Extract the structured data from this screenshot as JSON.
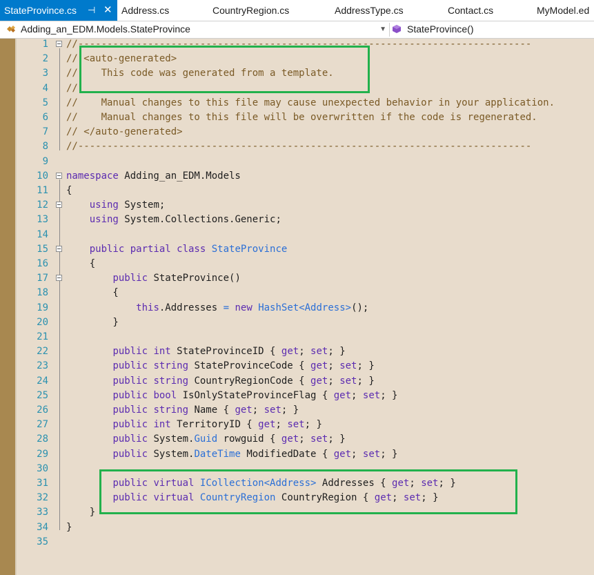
{
  "tabs": [
    {
      "label": "StateProvince.cs",
      "active": true
    },
    {
      "label": "Address.cs"
    },
    {
      "label": "CountryRegion.cs"
    },
    {
      "label": "AddressType.cs"
    },
    {
      "label": "Contact.cs"
    },
    {
      "label": "MyModel.ed"
    }
  ],
  "tab_icons": {
    "pin": "⊣",
    "close": "✕"
  },
  "navbar": {
    "type_scope": "Adding_an_EDM.Models.StateProvince",
    "member_scope": "StateProvince()"
  },
  "colors": {
    "accent": "#007acc",
    "keyword": "#5b2bb0",
    "type": "#2b6fd6",
    "comment": "#7a5a26",
    "line_number": "#2b91af",
    "highlight": "#22b14c",
    "editor_bg": "#e8dccc"
  },
  "lines": [
    {
      "n": "1",
      "fold": true,
      "tokens": [
        {
          "t": "//------------------------------------------------------------------------------",
          "c": "cm"
        }
      ]
    },
    {
      "n": "2",
      "tokens": [
        {
          "t": "// <auto-generated>",
          "c": "cm"
        }
      ]
    },
    {
      "n": "3",
      "tokens": [
        {
          "t": "//    This code was generated from a template.",
          "c": "cm"
        }
      ]
    },
    {
      "n": "4",
      "tokens": [
        {
          "t": "//",
          "c": "cm"
        }
      ]
    },
    {
      "n": "5",
      "tokens": [
        {
          "t": "//    Manual changes to this file may cause unexpected behavior in your application.",
          "c": "cm"
        }
      ]
    },
    {
      "n": "6",
      "tokens": [
        {
          "t": "//    Manual changes to this file will be overwritten if the code is regenerated.",
          "c": "cm"
        }
      ]
    },
    {
      "n": "7",
      "tokens": [
        {
          "t": "// </auto-generated>",
          "c": "cm"
        }
      ]
    },
    {
      "n": "8",
      "tokens": [
        {
          "t": "//------------------------------------------------------------------------------",
          "c": "cm"
        }
      ]
    },
    {
      "n": "9",
      "tokens": []
    },
    {
      "n": "10",
      "fold": true,
      "tokens": [
        {
          "t": "namespace",
          "c": "kw"
        },
        {
          "t": " Adding_an_EDM.Models",
          "c": ""
        }
      ]
    },
    {
      "n": "11",
      "tokens": [
        {
          "t": "{",
          "c": ""
        }
      ]
    },
    {
      "n": "12",
      "fold": true,
      "tokens": [
        {
          "t": "    ",
          "c": ""
        },
        {
          "t": "using",
          "c": "kw"
        },
        {
          "t": " System;",
          "c": ""
        }
      ]
    },
    {
      "n": "13",
      "tokens": [
        {
          "t": "    ",
          "c": ""
        },
        {
          "t": "using",
          "c": "kw"
        },
        {
          "t": " System.Collections.Generic;",
          "c": ""
        }
      ]
    },
    {
      "n": "14",
      "tokens": []
    },
    {
      "n": "15",
      "fold": true,
      "tokens": [
        {
          "t": "    ",
          "c": ""
        },
        {
          "t": "public partial class",
          "c": "kw"
        },
        {
          "t": " ",
          "c": ""
        },
        {
          "t": "StateProvince",
          "c": "ty"
        }
      ]
    },
    {
      "n": "16",
      "tokens": [
        {
          "t": "    {",
          "c": ""
        }
      ]
    },
    {
      "n": "17",
      "fold": true,
      "tokens": [
        {
          "t": "        ",
          "c": ""
        },
        {
          "t": "public",
          "c": "kw"
        },
        {
          "t": " StateProvince()",
          "c": ""
        }
      ]
    },
    {
      "n": "18",
      "tokens": [
        {
          "t": "        {",
          "c": ""
        }
      ]
    },
    {
      "n": "19",
      "tokens": [
        {
          "t": "            ",
          "c": ""
        },
        {
          "t": "this",
          "c": "kw"
        },
        {
          "t": ".Addresses ",
          "c": ""
        },
        {
          "t": "=",
          "c": "ty"
        },
        {
          "t": " ",
          "c": ""
        },
        {
          "t": "new",
          "c": "kw"
        },
        {
          "t": " ",
          "c": ""
        },
        {
          "t": "HashSet<Address>",
          "c": "ty"
        },
        {
          "t": "();",
          "c": ""
        }
      ]
    },
    {
      "n": "20",
      "tokens": [
        {
          "t": "        }",
          "c": ""
        }
      ]
    },
    {
      "n": "21",
      "tokens": []
    },
    {
      "n": "22",
      "tokens": [
        {
          "t": "        ",
          "c": ""
        },
        {
          "t": "public int",
          "c": "kw"
        },
        {
          "t": " StateProvinceID { ",
          "c": ""
        },
        {
          "t": "get",
          "c": "kw"
        },
        {
          "t": "; ",
          "c": ""
        },
        {
          "t": "set",
          "c": "kw"
        },
        {
          "t": "; }",
          "c": ""
        }
      ]
    },
    {
      "n": "23",
      "tokens": [
        {
          "t": "        ",
          "c": ""
        },
        {
          "t": "public string",
          "c": "kw"
        },
        {
          "t": " StateProvinceCode { ",
          "c": ""
        },
        {
          "t": "get",
          "c": "kw"
        },
        {
          "t": "; ",
          "c": ""
        },
        {
          "t": "set",
          "c": "kw"
        },
        {
          "t": "; }",
          "c": ""
        }
      ]
    },
    {
      "n": "24",
      "tokens": [
        {
          "t": "        ",
          "c": ""
        },
        {
          "t": "public string",
          "c": "kw"
        },
        {
          "t": " CountryRegionCode { ",
          "c": ""
        },
        {
          "t": "get",
          "c": "kw"
        },
        {
          "t": "; ",
          "c": ""
        },
        {
          "t": "set",
          "c": "kw"
        },
        {
          "t": "; }",
          "c": ""
        }
      ]
    },
    {
      "n": "25",
      "tokens": [
        {
          "t": "        ",
          "c": ""
        },
        {
          "t": "public bool",
          "c": "kw"
        },
        {
          "t": " IsOnlyStateProvinceFlag { ",
          "c": ""
        },
        {
          "t": "get",
          "c": "kw"
        },
        {
          "t": "; ",
          "c": ""
        },
        {
          "t": "set",
          "c": "kw"
        },
        {
          "t": "; }",
          "c": ""
        }
      ]
    },
    {
      "n": "26",
      "tokens": [
        {
          "t": "        ",
          "c": ""
        },
        {
          "t": "public string",
          "c": "kw"
        },
        {
          "t": " Name { ",
          "c": ""
        },
        {
          "t": "get",
          "c": "kw"
        },
        {
          "t": "; ",
          "c": ""
        },
        {
          "t": "set",
          "c": "kw"
        },
        {
          "t": "; }",
          "c": ""
        }
      ]
    },
    {
      "n": "27",
      "tokens": [
        {
          "t": "        ",
          "c": ""
        },
        {
          "t": "public int",
          "c": "kw"
        },
        {
          "t": " TerritoryID { ",
          "c": ""
        },
        {
          "t": "get",
          "c": "kw"
        },
        {
          "t": "; ",
          "c": ""
        },
        {
          "t": "set",
          "c": "kw"
        },
        {
          "t": "; }",
          "c": ""
        }
      ]
    },
    {
      "n": "28",
      "tokens": [
        {
          "t": "        ",
          "c": ""
        },
        {
          "t": "public",
          "c": "kw"
        },
        {
          "t": " System.",
          "c": ""
        },
        {
          "t": "Guid",
          "c": "ty"
        },
        {
          "t": " rowguid { ",
          "c": ""
        },
        {
          "t": "get",
          "c": "kw"
        },
        {
          "t": "; ",
          "c": ""
        },
        {
          "t": "set",
          "c": "kw"
        },
        {
          "t": "; }",
          "c": ""
        }
      ]
    },
    {
      "n": "29",
      "tokens": [
        {
          "t": "        ",
          "c": ""
        },
        {
          "t": "public",
          "c": "kw"
        },
        {
          "t": " System.",
          "c": ""
        },
        {
          "t": "DateTime",
          "c": "ty"
        },
        {
          "t": " ModifiedDate { ",
          "c": ""
        },
        {
          "t": "get",
          "c": "kw"
        },
        {
          "t": "; ",
          "c": ""
        },
        {
          "t": "set",
          "c": "kw"
        },
        {
          "t": "; }",
          "c": ""
        }
      ]
    },
    {
      "n": "30",
      "tokens": []
    },
    {
      "n": "31",
      "tokens": [
        {
          "t": "        ",
          "c": ""
        },
        {
          "t": "public virtual",
          "c": "kw"
        },
        {
          "t": " ",
          "c": ""
        },
        {
          "t": "ICollection<Address>",
          "c": "ty"
        },
        {
          "t": " Addresses { ",
          "c": ""
        },
        {
          "t": "get",
          "c": "kw"
        },
        {
          "t": "; ",
          "c": ""
        },
        {
          "t": "set",
          "c": "kw"
        },
        {
          "t": "; }",
          "c": ""
        }
      ]
    },
    {
      "n": "32",
      "tokens": [
        {
          "t": "        ",
          "c": ""
        },
        {
          "t": "public virtual",
          "c": "kw"
        },
        {
          "t": " ",
          "c": ""
        },
        {
          "t": "CountryRegion",
          "c": "ty"
        },
        {
          "t": " CountryRegion { ",
          "c": ""
        },
        {
          "t": "get",
          "c": "kw"
        },
        {
          "t": "; ",
          "c": ""
        },
        {
          "t": "set",
          "c": "kw"
        },
        {
          "t": "; }",
          "c": ""
        }
      ]
    },
    {
      "n": "33",
      "tokens": [
        {
          "t": "    }",
          "c": ""
        }
      ]
    },
    {
      "n": "34",
      "tokens": [
        {
          "t": "}",
          "c": ""
        }
      ]
    },
    {
      "n": "35",
      "tokens": []
    }
  ]
}
